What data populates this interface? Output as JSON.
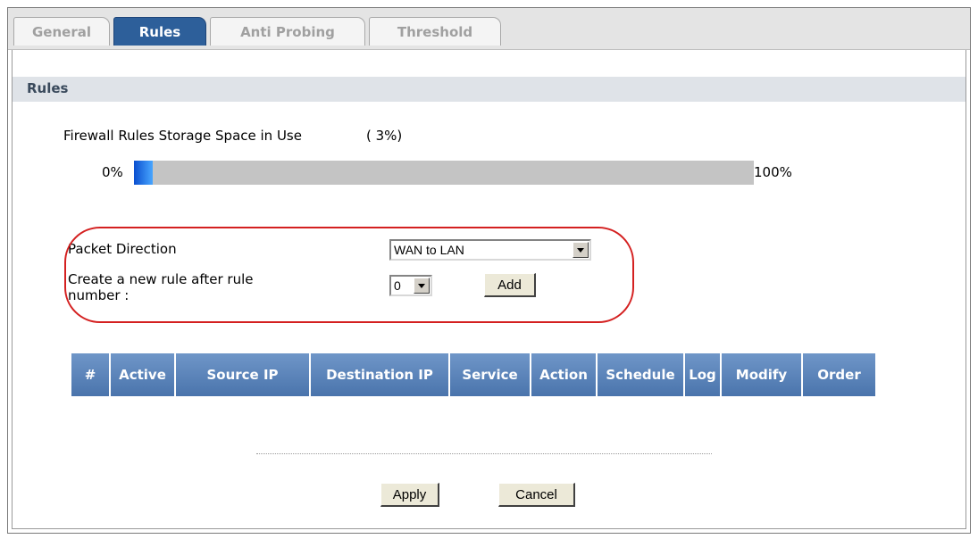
{
  "tabs": [
    {
      "label": "General",
      "active": false
    },
    {
      "label": "Rules",
      "active": true
    },
    {
      "label": "Anti Probing",
      "active": false
    },
    {
      "label": "Threshold",
      "active": false
    }
  ],
  "section": {
    "title": "Rules"
  },
  "storage": {
    "label": "Firewall Rules Storage Space in Use",
    "percent_text": "( 3%)",
    "fill_percent": 3,
    "min_label": "0%",
    "max_label": "100%"
  },
  "packet_direction": {
    "label": "Packet Direction",
    "selected": "WAN to LAN"
  },
  "new_rule": {
    "label_line1": "Create a new rule after rule",
    "label_line2": "number :",
    "selected": "0",
    "add_label": "Add"
  },
  "rules_table": {
    "columns": [
      "#",
      "Active",
      "Source IP",
      "Destination IP",
      "Service",
      "Action",
      "Schedule",
      "Log",
      "Modify",
      "Order"
    ],
    "rows": []
  },
  "buttons": {
    "apply": "Apply",
    "cancel": "Cancel"
  },
  "colors": {
    "header_bg": "#4a74ac",
    "active_tab": "#2d5f9a",
    "highlight": "#d42020"
  }
}
